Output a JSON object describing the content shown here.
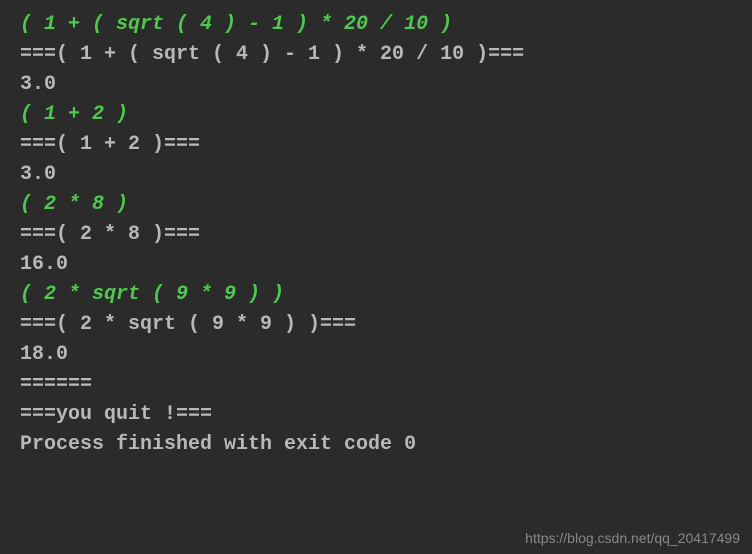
{
  "terminal": {
    "blocks": [
      {
        "input": "( 1 + ( sqrt ( 4 ) - 1 ) * 20 / 10 )",
        "echo": "===( 1 + ( sqrt ( 4 ) - 1 ) * 20 / 10 )===",
        "result": "3.0"
      },
      {
        "input": "( 1 + 2 )",
        "echo": "===( 1 + 2 )===",
        "result": "3.0"
      },
      {
        "input": "( 2 * 8 )",
        "echo": "===( 2 * 8 )===",
        "result": "16.0"
      },
      {
        "input": "( 2 * sqrt ( 9 * 9 ) )",
        "echo": "===( 2 * sqrt ( 9 * 9 ) )===",
        "result": "18.0"
      }
    ],
    "footer": {
      "separator": "======",
      "quit_message": "===you quit !===",
      "blank": "",
      "exit_message": "Process finished with exit code 0"
    }
  },
  "watermark": "https://blog.csdn.net/qq_20417499"
}
